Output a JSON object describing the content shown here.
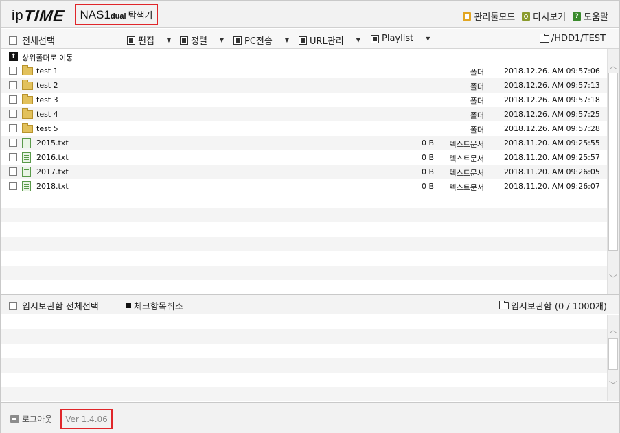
{
  "header": {
    "logo_ip": "ip",
    "logo_time": "TIME",
    "product_name": "NAS1",
    "product_suffix": "dual",
    "product_title": "탐색기",
    "links": [
      {
        "label": "관리툴모드",
        "icon": "admin-icon"
      },
      {
        "label": "다시보기",
        "icon": "reload-icon"
      },
      {
        "label": "도움말",
        "icon": "help-icon"
      }
    ]
  },
  "toolbar": {
    "select_all": "전체선택",
    "buttons": [
      {
        "label": "편집",
        "icon": "edit-icon"
      },
      {
        "label": "정렬",
        "icon": "sort-icon"
      },
      {
        "label": "PC전송",
        "icon": "pc-transfer-icon"
      },
      {
        "label": "URL관리",
        "icon": "url-icon"
      },
      {
        "label": "Playlist",
        "icon": "playlist-icon"
      }
    ],
    "current_path": "/HDD1/TEST"
  },
  "filelist": {
    "up_label": "상위폴더로 이동",
    "files": [
      {
        "name": "test 1",
        "size": "",
        "type": "폴더",
        "date": "2018.12.26. AM 09:57:06",
        "kind": "folder"
      },
      {
        "name": "test 2",
        "size": "",
        "type": "폴더",
        "date": "2018.12.26. AM 09:57:13",
        "kind": "folder"
      },
      {
        "name": "test 3",
        "size": "",
        "type": "폴더",
        "date": "2018.12.26. AM 09:57:18",
        "kind": "folder"
      },
      {
        "name": "test 4",
        "size": "",
        "type": "폴더",
        "date": "2018.12.26. AM 09:57:25",
        "kind": "folder"
      },
      {
        "name": "test 5",
        "size": "",
        "type": "폴더",
        "date": "2018.12.26. AM 09:57:28",
        "kind": "folder"
      },
      {
        "name": "2015.txt",
        "size": "0 B",
        "type": "텍스트문서",
        "date": "2018.11.20. AM 09:25:55",
        "kind": "text"
      },
      {
        "name": "2016.txt",
        "size": "0 B",
        "type": "텍스트문서",
        "date": "2018.11.20. AM 09:25:57",
        "kind": "text"
      },
      {
        "name": "2017.txt",
        "size": "0 B",
        "type": "텍스트문서",
        "date": "2018.11.20. AM 09:26:05",
        "kind": "text"
      },
      {
        "name": "2018.txt",
        "size": "0 B",
        "type": "텍스트문서",
        "date": "2018.11.20. AM 09:26:07",
        "kind": "text"
      }
    ]
  },
  "temp": {
    "select_all": "임시보관함 전체선택",
    "uncheck": "체크항목취소",
    "count_label": "임시보관함 (0 / 1000개)"
  },
  "footer": {
    "logout": "로그아웃",
    "version": "Ver 1.4.06"
  },
  "colors": {
    "highlight_box": "#e0262a",
    "folder": "#e2c15c",
    "text_file": "#5a9a4a"
  }
}
